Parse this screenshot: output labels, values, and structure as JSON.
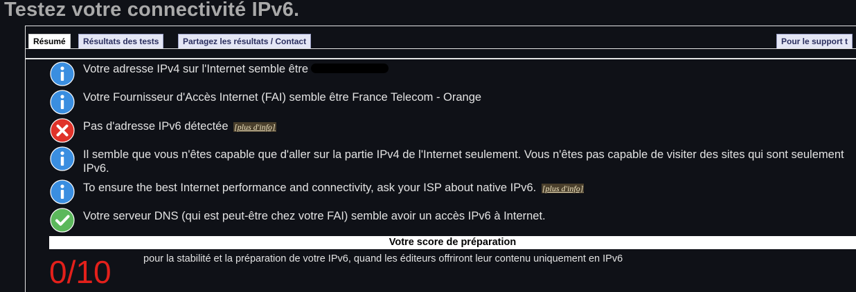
{
  "header": {
    "title": "Testez votre connectivité IPv6."
  },
  "tabs": [
    {
      "label": "Résumé",
      "active": true
    },
    {
      "label": "Résultats des tests",
      "active": false
    },
    {
      "label": "Partagez les résultats / Contact",
      "active": false
    },
    {
      "label": "Pour le support t",
      "active": false
    }
  ],
  "results": [
    {
      "icon": "info-icon",
      "text": "Votre adresse IPv4 sur l'Internet semble être",
      "redacted": true
    },
    {
      "icon": "info-icon",
      "text": "Votre Fournisseur d'Accès Internet (FAI) semble être France Telecom - Orange"
    },
    {
      "icon": "error-icon",
      "text": "Pas d'adresse IPv6 détectée",
      "link": "[plus d'info]"
    },
    {
      "icon": "info-icon",
      "text": "Il semble que vous n'êtes capable que d'aller sur la partie IPv4 de l'Internet seulement. Vous n'êtes pas capable de visiter des sites qui sont seulement IPv6."
    },
    {
      "icon": "info-icon",
      "text": "To ensure the best Internet performance and connectivity, ask your ISP about native IPv6.",
      "link": "[plus d'info]"
    },
    {
      "icon": "check-icon",
      "text": "Votre serveur DNS (qui est peut-être chez votre FAI) semble avoir un accès IPv6 à Internet."
    }
  ],
  "score": {
    "heading": "Votre score de préparation",
    "value": "0/10",
    "description": "pour la stabilité et la préparation de votre IPv6, quand les éditeurs offriront leur contenu uniquement en IPv6"
  },
  "colors": {
    "background": "#0f1117",
    "info": "#3a8ee0",
    "error": "#e0332a",
    "success": "#5cb85c",
    "score": "#e3201b"
  }
}
